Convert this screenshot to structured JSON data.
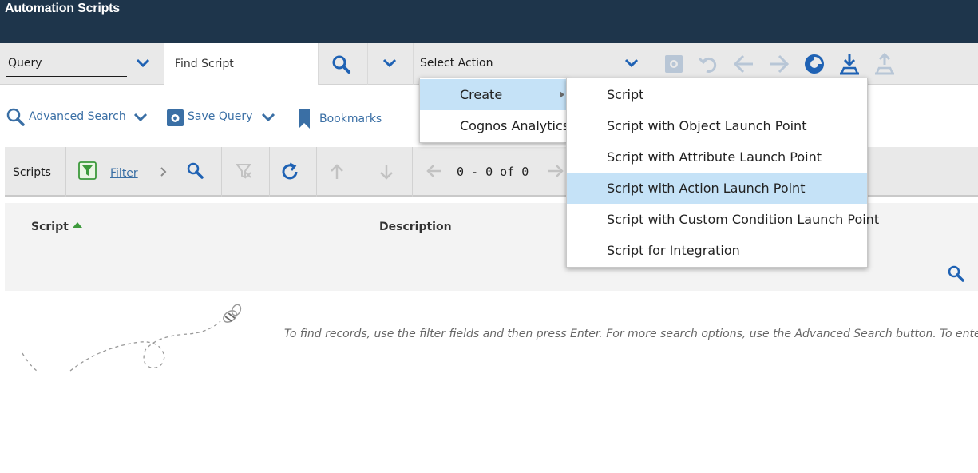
{
  "app": {
    "title": "Automation Scripts"
  },
  "toolbar": {
    "query_value": "Query",
    "find_placeholder": "Find Script",
    "select_action_value": "Select Action"
  },
  "options": {
    "advanced_search": "Advanced Search",
    "save_query": "Save Query",
    "bookmarks": "Bookmarks"
  },
  "list": {
    "tab_label": "Scripts",
    "filter_label": "Filter",
    "paging": "0 - 0 of 0"
  },
  "table": {
    "columns": [
      {
        "label": "Script",
        "sorted": "asc"
      },
      {
        "label": "Description"
      }
    ]
  },
  "empty_hint": "To find records, use the filter fields and then press Enter. For more search options, use the Advanced Search button. To enter a new r",
  "action_menu": {
    "items": [
      {
        "label": "Create",
        "has_submenu": true,
        "highlighted": true
      },
      {
        "label": "Cognos Analytics",
        "has_submenu": false,
        "highlighted": false
      }
    ]
  },
  "create_submenu": {
    "items": [
      {
        "label": "Script"
      },
      {
        "label": "Script with Object Launch Point"
      },
      {
        "label": "Script with Attribute Launch Point"
      },
      {
        "label": "Script with Action Launch Point",
        "highlighted": true
      },
      {
        "label": "Script with Custom Condition Launch Point"
      },
      {
        "label": "Script for Integration"
      }
    ]
  },
  "colors": {
    "header_bg": "#1e354b",
    "accent_blue": "#3a6fa5",
    "icon_blue": "#1f62b4",
    "highlight": "#c5e2f7",
    "filter_green": "#3d9a3c"
  }
}
